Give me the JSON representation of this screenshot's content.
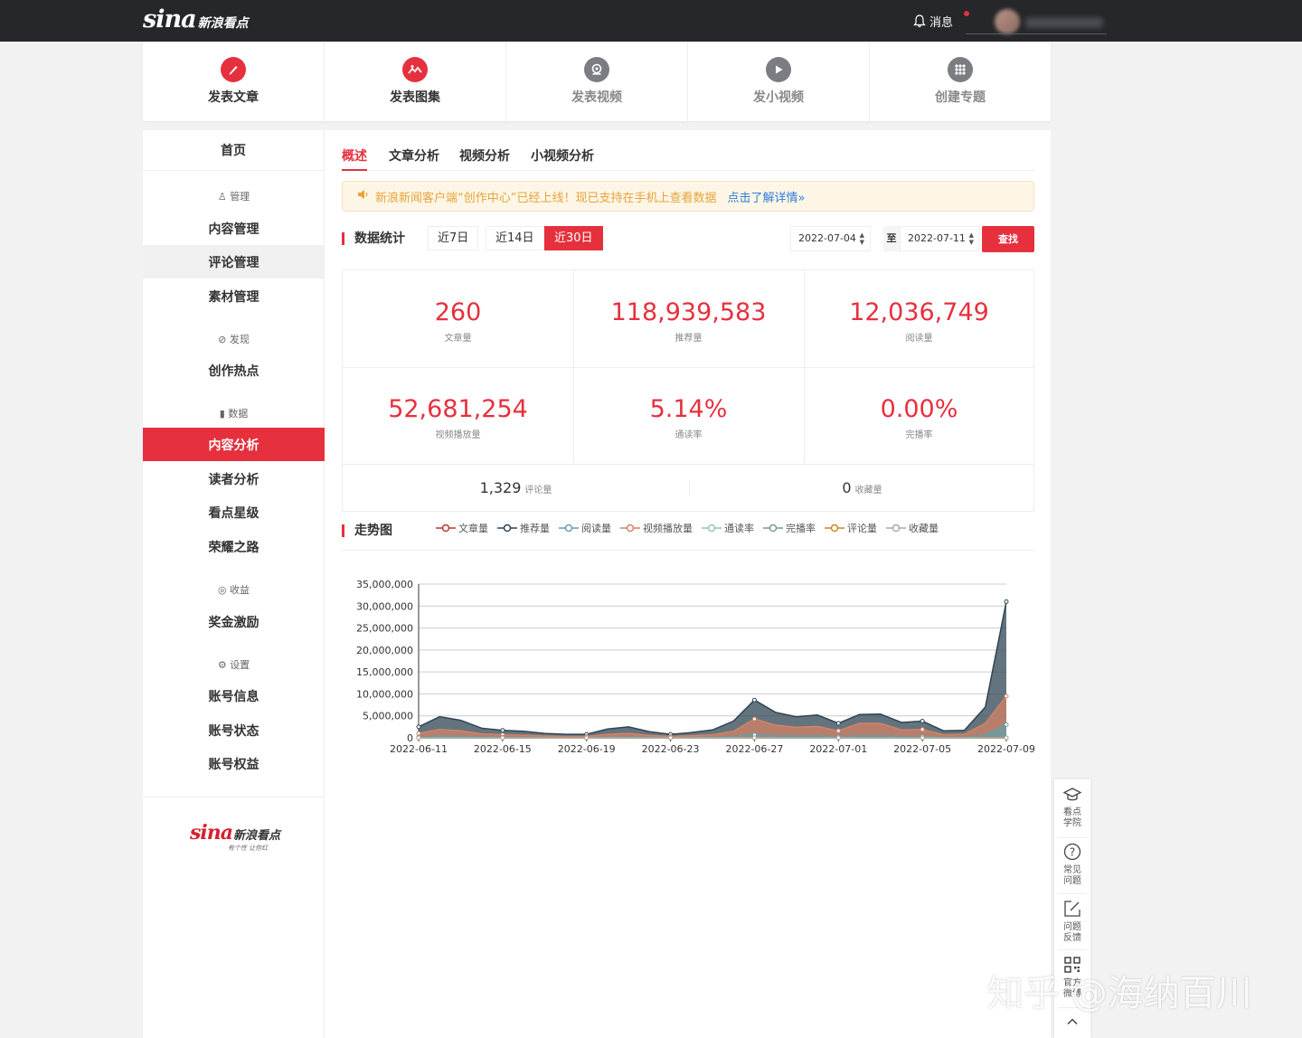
{
  "topbar": {
    "logo_sina": "sina",
    "logo_kandian": "新浪看点",
    "messages_label": "消息"
  },
  "actions": [
    {
      "label": "发表文章",
      "icon": "pen-icon",
      "style": "red"
    },
    {
      "label": "发表图集",
      "icon": "image-icon",
      "style": "red"
    },
    {
      "label": "发表视频",
      "icon": "video-disc-icon",
      "style": "gray"
    },
    {
      "label": "发小视频",
      "icon": "play-icon",
      "style": "gray"
    },
    {
      "label": "创建专题",
      "icon": "grid-icon",
      "style": "gray"
    }
  ],
  "sidebar": {
    "home": "首页",
    "sections": [
      {
        "label": "管理",
        "icon": "user-icon"
      },
      {
        "label": "发现",
        "icon": "compass-icon"
      },
      {
        "label": "数据",
        "icon": "bar-chart-icon"
      },
      {
        "label": "收益",
        "icon": "coin-icon"
      },
      {
        "label": "设置",
        "icon": "gear-icon"
      }
    ],
    "items": [
      "内容管理",
      "评论管理",
      "素材管理",
      "创作热点",
      "内容分析",
      "读者分析",
      "看点星级",
      "荣耀之路",
      "奖金激励",
      "账号信息",
      "账号状态",
      "账号权益"
    ],
    "logo_sina": "sina",
    "logo_kandian": "新浪看点",
    "slogan": "有个性  让你红"
  },
  "tabs": [
    "概述",
    "文章分析",
    "视频分析",
    "小视频分析"
  ],
  "notice": {
    "text": "新浪新闻客户端“创作中心”已经上线！现已支持在手机上查看数据",
    "link": "点击了解详情»"
  },
  "stats_title": "数据统计",
  "ranges": [
    "近7日",
    "近14日",
    "近30日"
  ],
  "date_from": "2022-07-04",
  "date_to": "2022-07-11",
  "to_label": "至",
  "search_label": "查找",
  "stats": [
    {
      "value": "260",
      "label": "文章量"
    },
    {
      "value": "118,939,583",
      "label": "推荐量"
    },
    {
      "value": "12,036,749",
      "label": "阅读量"
    },
    {
      "value": "52,681,254",
      "label": "视频播放量"
    },
    {
      "value": "5.14%",
      "label": "通读率"
    },
    {
      "value": "0.00%",
      "label": "完播率"
    }
  ],
  "small_stats": [
    {
      "value": "1,329",
      "label": "评论量"
    },
    {
      "value": "0",
      "label": "收藏量"
    }
  ],
  "trend_title": "走势图",
  "floatbar": [
    {
      "label": "看点\n学院",
      "icon": "graduation-cap-icon"
    },
    {
      "label": "常见\n问题",
      "icon": "question-icon"
    },
    {
      "label": "问题\n反馈",
      "icon": "edit-icon"
    },
    {
      "label": "官方\n微博",
      "icon": "qr-code-icon"
    }
  ],
  "watermark": "知乎 @海纳百川",
  "chart_data": {
    "type": "area",
    "ylim": [
      0,
      35000000
    ],
    "yticks": [
      "0",
      "5,000,000",
      "10,000,000",
      "15,000,000",
      "20,000,000",
      "25,000,000",
      "30,000,000",
      "35,000,000"
    ],
    "xticks": [
      "2022-06-11",
      "2022-06-15",
      "2022-06-19",
      "2022-06-23",
      "2022-06-27",
      "2022-07-01",
      "2022-07-05",
      "2022-07-09"
    ],
    "x": [
      "2022-06-11",
      "2022-06-12",
      "2022-06-13",
      "2022-06-14",
      "2022-06-15",
      "2022-06-16",
      "2022-06-17",
      "2022-06-18",
      "2022-06-19",
      "2022-06-20",
      "2022-06-21",
      "2022-06-22",
      "2022-06-23",
      "2022-06-24",
      "2022-06-25",
      "2022-06-26",
      "2022-06-27",
      "2022-06-28",
      "2022-06-29",
      "2022-06-30",
      "2022-07-01",
      "2022-07-02",
      "2022-07-03",
      "2022-07-04",
      "2022-07-05",
      "2022-07-06",
      "2022-07-07",
      "2022-07-08",
      "2022-07-09"
    ],
    "series": [
      {
        "name": "文章量",
        "color": "#c23531",
        "values": [
          8,
          9,
          10,
          9,
          8,
          9,
          9,
          8,
          8,
          9,
          9,
          8,
          8,
          9,
          9,
          9,
          10,
          9,
          9,
          8,
          9,
          9,
          9,
          8,
          9,
          9,
          9,
          9,
          8
        ]
      },
      {
        "name": "推荐量",
        "color": "#2f4554",
        "values": [
          2500000,
          4800000,
          4000000,
          2200000,
          1700000,
          1500000,
          1000000,
          800000,
          800000,
          2000000,
          2500000,
          1400000,
          800000,
          1200000,
          1800000,
          3800000,
          8600000,
          5800000,
          4800000,
          5200000,
          3300000,
          5300000,
          5400000,
          3500000,
          3800000,
          1600000,
          1700000,
          7000000,
          31000000
        ]
      },
      {
        "name": "阅读量",
        "color": "#61a0a8",
        "values": [
          200000,
          350000,
          300000,
          200000,
          150000,
          130000,
          100000,
          80000,
          80000,
          160000,
          200000,
          130000,
          80000,
          100000,
          150000,
          300000,
          700000,
          450000,
          380000,
          400000,
          260000,
          420000,
          430000,
          280000,
          300000,
          130000,
          140000,
          600000,
          3000000
        ]
      },
      {
        "name": "视频播放量",
        "color": "#d48265",
        "values": [
          1000000,
          1900000,
          1600000,
          900000,
          700000,
          600000,
          400000,
          300000,
          300000,
          800000,
          1000000,
          550000,
          300000,
          480000,
          700000,
          1500000,
          4300000,
          2900000,
          2400000,
          2600000,
          1600000,
          3300000,
          3300000,
          1800000,
          1900000,
          700000,
          800000,
          3300000,
          9500000
        ]
      },
      {
        "name": "通读率",
        "color": "#91c7ae",
        "values": [
          0,
          0,
          0,
          0,
          0,
          0,
          0,
          0,
          0,
          0,
          0,
          0,
          0,
          0,
          0,
          0,
          0,
          0,
          0,
          0,
          0,
          0,
          0,
          0,
          0,
          0,
          0,
          0,
          0
        ]
      },
      {
        "name": "完播率",
        "color": "#749f83",
        "values": [
          0,
          0,
          0,
          0,
          0,
          0,
          0,
          0,
          0,
          0,
          0,
          0,
          0,
          0,
          0,
          0,
          0,
          0,
          0,
          0,
          0,
          0,
          0,
          0,
          0,
          0,
          0,
          0,
          0
        ]
      },
      {
        "name": "评论量",
        "color": "#ca8622",
        "values": [
          40,
          50,
          45,
          40,
          35,
          35,
          30,
          25,
          25,
          40,
          45,
          35,
          25,
          30,
          40,
          50,
          80,
          60,
          55,
          55,
          45,
          60,
          60,
          45,
          45,
          30,
          30,
          60,
          120
        ]
      },
      {
        "name": "收藏量",
        "color": "#bda29a",
        "values": [
          0,
          0,
          0,
          0,
          0,
          0,
          0,
          0,
          0,
          0,
          0,
          0,
          0,
          0,
          0,
          0,
          0,
          0,
          0,
          0,
          0,
          0,
          0,
          0,
          0,
          0,
          0,
          0,
          0
        ]
      }
    ]
  }
}
